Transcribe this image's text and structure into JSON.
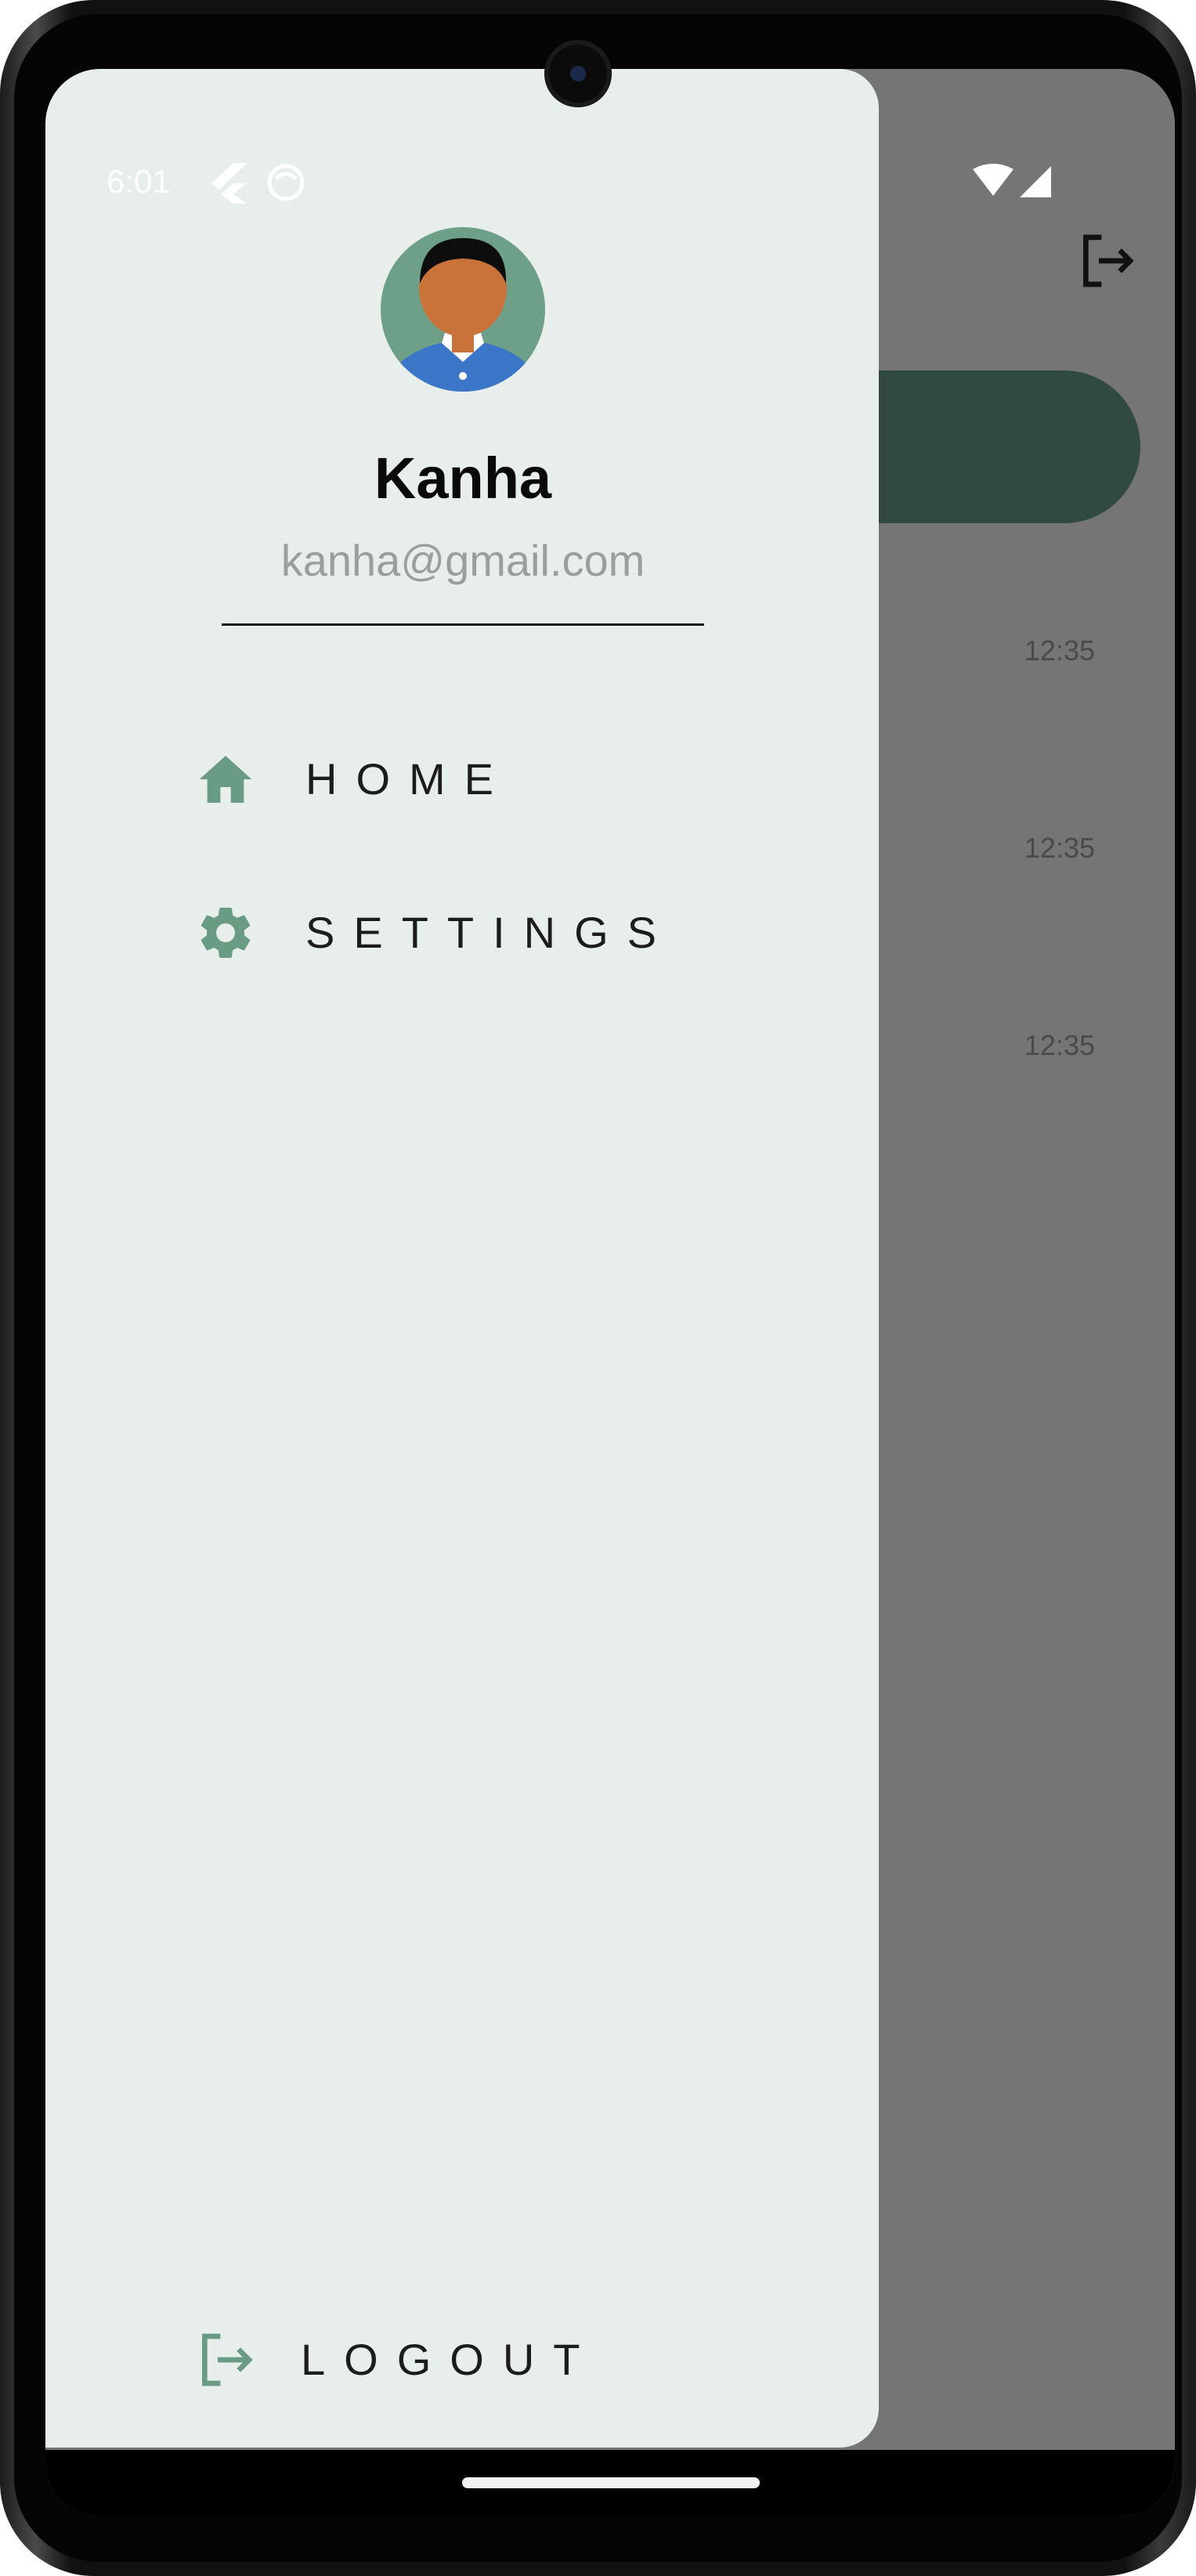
{
  "status_bar": {
    "time": "6:01"
  },
  "background_app": {
    "times": [
      "12:35",
      "12:35",
      "12:35"
    ]
  },
  "drawer": {
    "user": {
      "name": "Kanha",
      "email": "kanha@gmail.com"
    },
    "menu": [
      {
        "label": "HOME",
        "icon": "home-icon"
      },
      {
        "label": "SETTINGS",
        "icon": "gear-icon"
      }
    ],
    "logout": {
      "label": "LOGOUT",
      "icon": "logout-icon"
    }
  },
  "colors": {
    "drawer_bg": "#e7eeeb",
    "accent": "#6a9c85",
    "scrim": "#757575",
    "pill": "#314a40"
  }
}
